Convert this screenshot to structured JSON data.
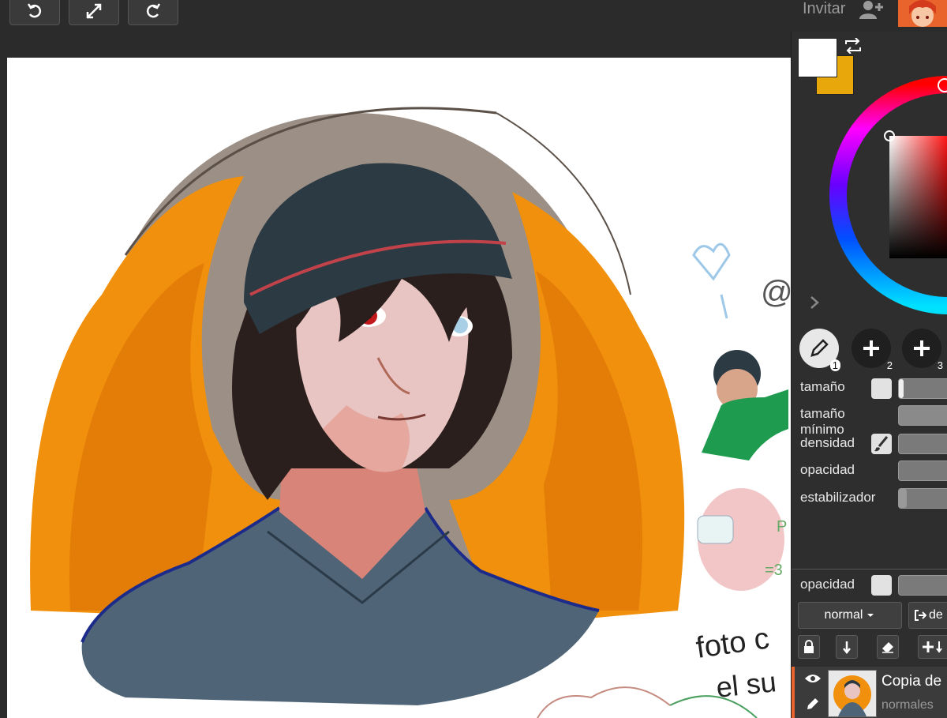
{
  "topbar": {
    "invite_label": "Invitar"
  },
  "colors": {
    "foreground": "#ffffff",
    "background": "#e8a80c"
  },
  "brushes": [
    {
      "icon": "pencil-icon",
      "number": "1"
    },
    {
      "icon": "plus-icon",
      "number": "2"
    },
    {
      "icon": "plus-icon",
      "number": "3"
    }
  ],
  "brush_settings": {
    "size_label": "tamaño",
    "min_size_label": "tamaño mínimo",
    "density_label": "densidad",
    "opacity_label": "opacidad",
    "stabilizer_label": "estabilizador"
  },
  "layer_settings": {
    "opacity_label": "opacidad",
    "blend_mode": "normal",
    "action_label": "de"
  },
  "layers": [
    {
      "name": "Copia de",
      "type": "normales"
    }
  ],
  "canvas_text": {
    "handle": "@N",
    "note_line1": "foto c",
    "note_line2": "el su",
    "pink_text": "P",
    "pink_text2": "=3"
  }
}
